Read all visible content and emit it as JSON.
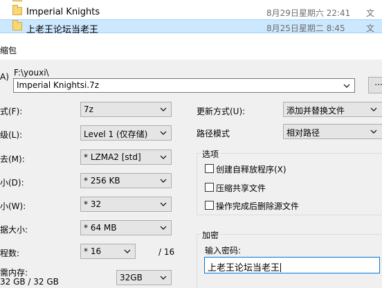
{
  "explorer": {
    "rows": [
      {
        "name": "",
        "date": "",
        "type": ""
      },
      {
        "name": "Imperial Knights",
        "date": "8月29日星期六 22:41",
        "type": "文"
      },
      {
        "name": "上老王论坛当老王",
        "date": "8月25日星期二 8:45",
        "type": "文"
      }
    ]
  },
  "dialog": {
    "title": "缩包",
    "archive": {
      "label": "A)",
      "path": "F:\\youxi\\",
      "filename": "Imperial Knightsi.7z",
      "browse_label": "..."
    },
    "left": {
      "format_label": "式(F):",
      "format_value": "7z",
      "level_label": "级(L):",
      "level_value": "Level 1 (仅存储)",
      "method_label": "去(M):",
      "method_value": "* LZMA2 [std]",
      "dict_label": "小(D):",
      "dict_value": "* 256 KB",
      "word_label": "小(W):",
      "word_value": "* 32",
      "solid_label": "据大小:",
      "solid_value": "* 64 MB",
      "threads_label": "程数:",
      "threads_value": "* 16",
      "threads_max": "/ 16",
      "memory_label": "需内存:",
      "memory_usage": "32 GB / 32 GB",
      "memory_value": "32GB"
    },
    "right": {
      "update_label": "更新方式(U):",
      "update_value": "添加并替换文件",
      "pathmode_label": "路径模式",
      "pathmode_value": "相对路径",
      "options": {
        "title": "选项",
        "sfx": "创建自释放程序(X)",
        "shared": "压缩共享文件",
        "delete": "操作完成后删除源文件"
      },
      "encryption": {
        "title": "加密",
        "password_label": "输入密码:",
        "password_value": "上老王论坛当老王"
      }
    }
  },
  "colors": {
    "selection": "#cce8ff",
    "focus_border": "#0078d7",
    "folder": "#f8d775"
  }
}
